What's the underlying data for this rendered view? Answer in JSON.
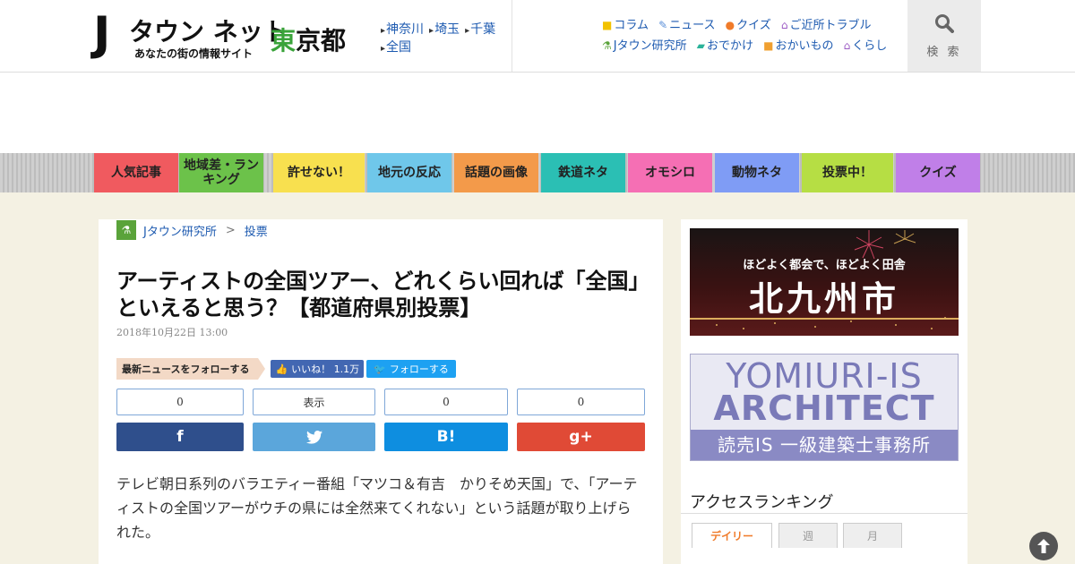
{
  "header": {
    "logo_j": "J",
    "logo_brand": "タウン ネット",
    "logo_tagline": "あなたの街の情報サイト",
    "pref_a": "東",
    "pref_b": "京都",
    "regions": [
      "神奈川",
      "埼玉",
      "千葉",
      "全国"
    ],
    "categories": [
      {
        "icon": "column-icon",
        "label": "コラム"
      },
      {
        "icon": "pen-icon",
        "label": "ニュース"
      },
      {
        "icon": "quiz-icon",
        "label": "クイズ"
      },
      {
        "icon": "house-icon",
        "label": "ご近所トラブル"
      },
      {
        "icon": "flask-icon",
        "label": "Jタウン研究所"
      },
      {
        "icon": "car-icon",
        "label": "おでかけ"
      },
      {
        "icon": "bag-icon",
        "label": "おかいもの"
      },
      {
        "icon": "home-icon",
        "label": "くらし"
      }
    ],
    "search_label": "検 索"
  },
  "nav": [
    {
      "label": "人気記事",
      "color": "#f05a5f"
    },
    {
      "label": "地域差・ランキング",
      "color": "#6cc24a"
    },
    {
      "label": "許せない！",
      "color": "#f8e04f"
    },
    {
      "label": "地元の反応",
      "color": "#6fc7ea"
    },
    {
      "label": "話題の画像",
      "color": "#f39a4a"
    },
    {
      "label": "鉄道ネタ",
      "color": "#2bbfb4"
    },
    {
      "label": "オモシロ",
      "color": "#f56fb4"
    },
    {
      "label": "動物ネタ",
      "color": "#7f9cf5"
    },
    {
      "label": "投票中！",
      "color": "#b6de44"
    },
    {
      "label": "クイズ",
      "color": "#c07fe8"
    }
  ],
  "article": {
    "breadcrumb": [
      "Jタウン研究所",
      "投票"
    ],
    "title": "アーティストの全国ツアー、どれくらい回れば「全国」といえると思う？【都道府県別投票】",
    "date": "2018年10月22日 13:00",
    "follow_label": "最新ニュースをフォローする",
    "fb_like": "いいね！ 1.1万",
    "tw_follow": "フォローする",
    "counts": [
      "0",
      "表示",
      "0",
      "0"
    ],
    "share_buttons": [
      {
        "label": "f",
        "color": "#2f4f8c"
      },
      {
        "label": "twitter-bird",
        "color": "#5ba6db"
      },
      {
        "label": "B!",
        "color": "#0e8ee0"
      },
      {
        "label": "g+",
        "color": "#e04a36"
      }
    ],
    "body_1": "テレビ朝日系列のバラエティー番組「マツコ＆有吉　かりそめ天国」で、「アーティストの全国ツアーがウチの県には全然来てくれない」という話題が取り上げられた。"
  },
  "sidebar": {
    "banner1_sub": "ほどよく都会で、ほどよく田舎",
    "banner1_city": "北九州市",
    "banner2_l1": "YOMIURI-IS",
    "banner2_l2": "ARCHITECT",
    "banner2_l3": "読売IS 一級建築士事務所",
    "ranking_title": "アクセスランキング",
    "tabs": [
      "デイリー",
      "週",
      "月"
    ]
  }
}
